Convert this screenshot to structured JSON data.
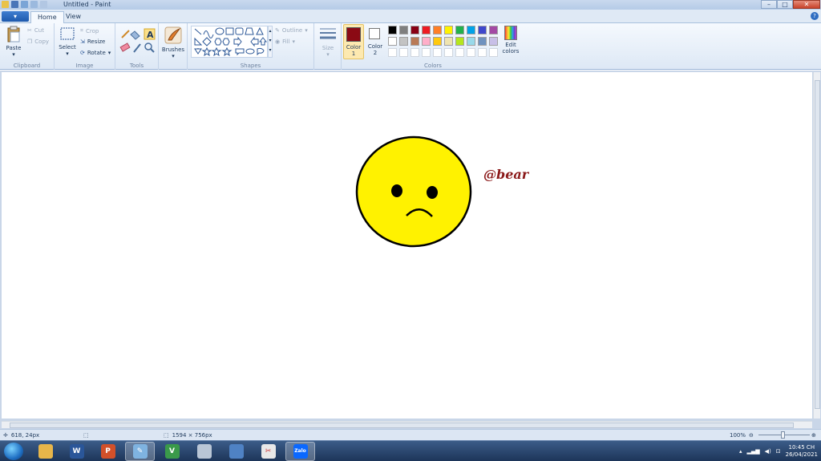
{
  "window": {
    "title": "Untitled - Paint",
    "controls": {
      "minimize": "–",
      "maximize": "□",
      "close": "✕"
    }
  },
  "tabs": {
    "home": "Home",
    "view": "View"
  },
  "clipboard": {
    "paste": "Paste",
    "cut": "Cut",
    "copy": "Copy",
    "label": "Clipboard"
  },
  "image": {
    "select": "Select",
    "crop": "Crop",
    "resize": "Resize",
    "rotate": "Rotate",
    "label": "Image"
  },
  "tools": {
    "label": "Tools"
  },
  "brushes": {
    "label": "Brushes"
  },
  "shapes": {
    "outline": "Outline",
    "fill": "Fill",
    "label": "Shapes"
  },
  "size": {
    "label": "Size"
  },
  "colors": {
    "color1": "Color\n1",
    "color2": "Color\n2",
    "color1_value": "#8b0a14",
    "color2_value": "#ffffff",
    "edit": "Edit\ncolors",
    "label": "Colors",
    "palette_row1": [
      "#000000",
      "#7f7f7f",
      "#880015",
      "#ed1c24",
      "#ff7f27",
      "#fff200",
      "#22b14c",
      "#00a2e8",
      "#3f48cc",
      "#a349a4"
    ],
    "palette_row2": [
      "#ffffff",
      "#c3c3c3",
      "#b97a57",
      "#ffaec9",
      "#ffc90e",
      "#efe4b0",
      "#b5e61d",
      "#99d9ea",
      "#7092be",
      "#c8bfe7"
    ]
  },
  "canvas": {
    "signature": "@bear",
    "signature_color": "#8b1a1a",
    "face_color": "#fff200"
  },
  "status": {
    "cursor": "618, 24px",
    "size": "1594 × 756px",
    "zoom": "100%"
  },
  "taskbar": {
    "time": "10:45 CH",
    "date": "26/04/2021",
    "apps": [
      "file-explorer",
      "word",
      "powerpoint",
      "paint",
      "unikey",
      "calculator",
      "network",
      "snipping-tool",
      "zalo"
    ]
  }
}
